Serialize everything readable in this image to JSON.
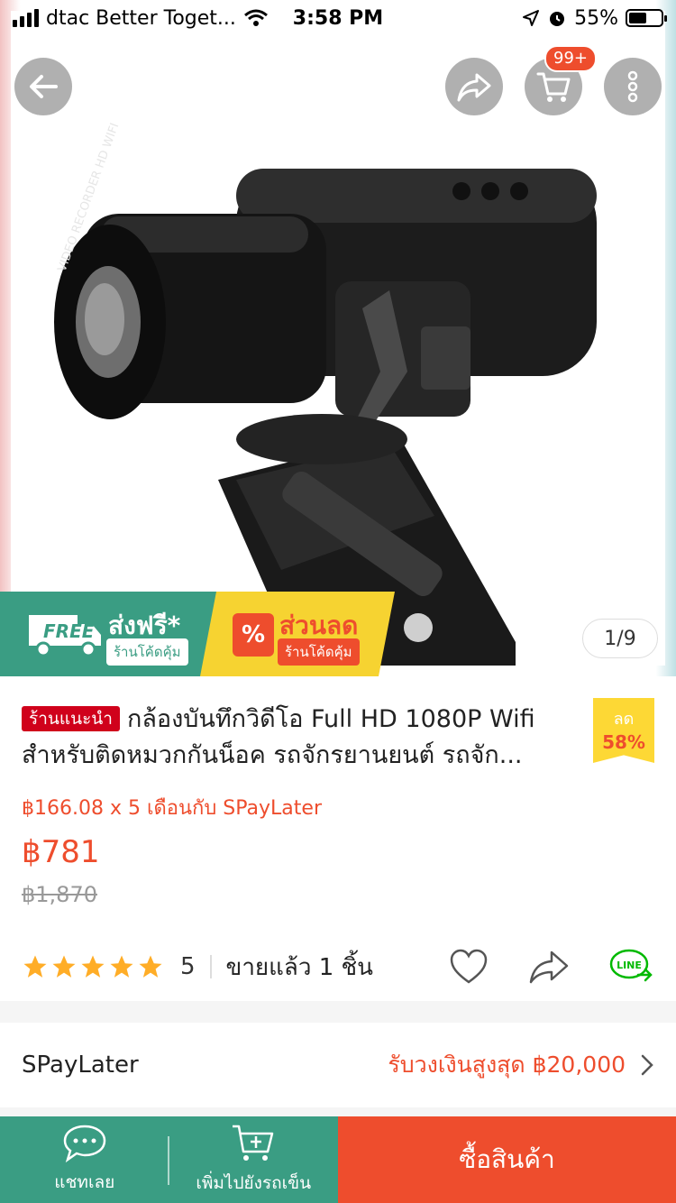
{
  "status_bar": {
    "carrier": "dtac Better Toget...",
    "time": "3:58 PM",
    "battery": "55%",
    "battery_level": 0.55
  },
  "hero": {
    "cart_badge": "99+",
    "pager": "1/9",
    "lens_text": "VIDEO RECORDER HD WIFI",
    "icons": [
      "back-arrow-icon",
      "share-icon",
      "cart-icon",
      "more-vertical-icon"
    ]
  },
  "banners": {
    "free_word": "FREE",
    "free_title": "ส่งฟรี*",
    "free_tag": "ร้านโค้ดคุ้ม",
    "sale_title": "ส่วนลด",
    "sale_tag": "ร้านโค้ดคุ้ม",
    "sale_symbol": "%"
  },
  "product": {
    "recommended_tag": "ร้านแนะนำ",
    "title": "กล้องบันทึกวิดีโอ Full HD 1080P Wifi สำหรับติดหมวกกันน็อค รถจักรยานยนต์ รถจัก...",
    "discount_label": "ลด",
    "discount_value": "58%",
    "installment": "฿166.08 x 5 เดือนกับ SPayLater",
    "price": "฿781",
    "original_price": "฿1,870",
    "rating": "5",
    "rating_stars": 5,
    "sold": "ขายแล้ว 1 ชิ้น",
    "line_label": "LINE"
  },
  "spaylater": {
    "label": "SPayLater",
    "limit": "รับวงเงินสูงสุด ฿20,000"
  },
  "bottom_bar": {
    "chat": "แชทเลย",
    "add_to_cart": "เพิ่มไปยังรถเข็น",
    "buy_now": "ซื้อสินค้า"
  },
  "colors": {
    "accent": "#ee4d2d",
    "green": "#3a9d83",
    "star": "#ffad27",
    "yellow": "#f6d331"
  }
}
